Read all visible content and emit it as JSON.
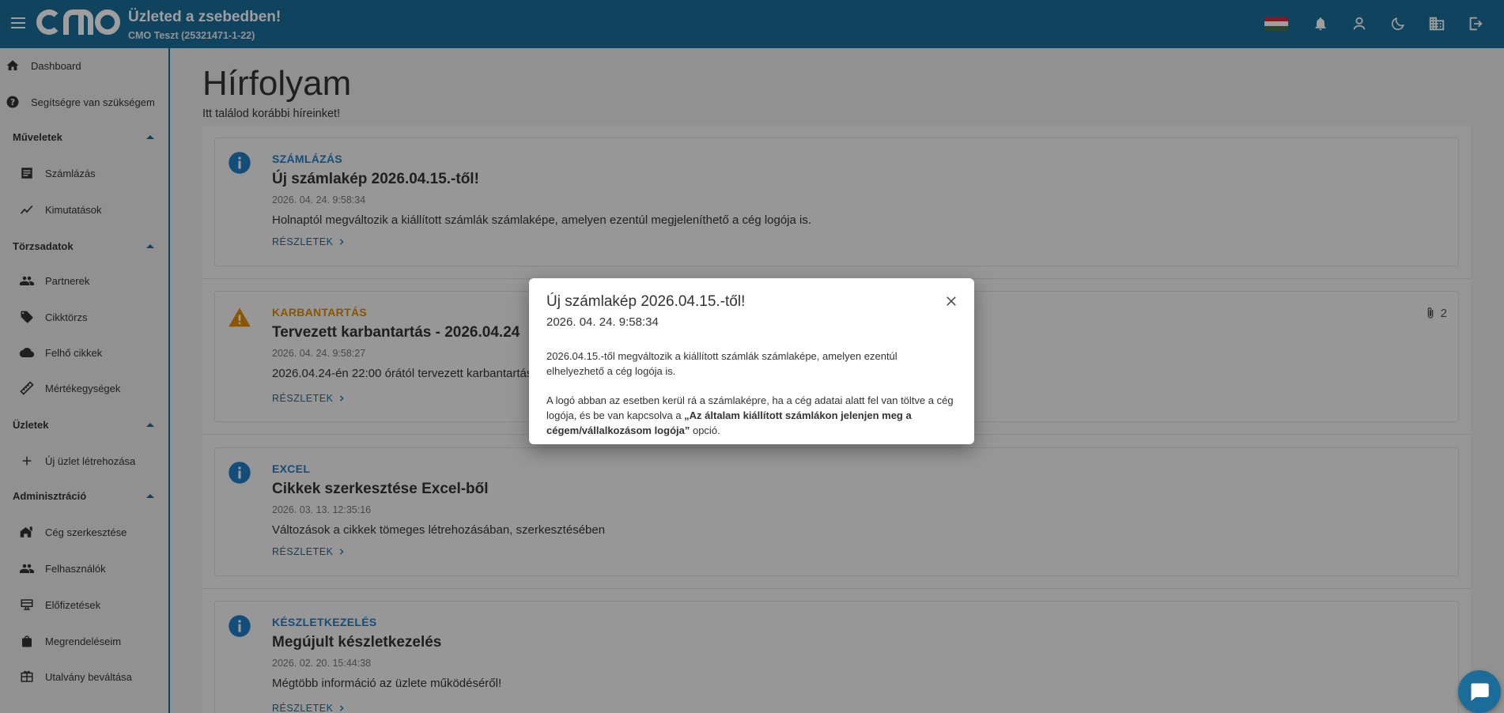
{
  "header": {
    "title": "Üzleted a zsebedben!",
    "subtitle": "CMO Teszt (25321471-1-22)",
    "flag_colors": [
      "#cd2a3e",
      "#ffffff",
      "#436f4d"
    ]
  },
  "sidebar": {
    "dashboard": "Dashboard",
    "help": "Segítségre van szükségem",
    "sections": [
      {
        "label": "Műveletek",
        "items": [
          "Számlázás",
          "Kimutatások"
        ]
      },
      {
        "label": "Törzsadatok",
        "items": [
          "Partnerek",
          "Cikktörzs",
          "Felhő cikkek",
          "Mértékegységek"
        ]
      },
      {
        "label": "Üzletek",
        "items": [
          "Új üzlet létrehozása"
        ]
      },
      {
        "label": "Adminisztráció",
        "items": [
          "Cég szerkesztése",
          "Felhasználók",
          "Előfizetések",
          "Megrendeléseim",
          "Utalvány beváltása"
        ]
      }
    ]
  },
  "main": {
    "title": "Hírfolyam",
    "subtitle": "Itt találod korábbi híreinket!",
    "details_label": "RÉSZLETEK",
    "news": [
      {
        "category": "SZÁMLÁZÁS",
        "category_color": "#1f7fc6",
        "icon": "info-icon",
        "title": "Új számlakép 2026.04.15.-től!",
        "date": "2026. 04. 24. 9:58:34",
        "text": "Holnaptól megváltozik a kiállított számlák számlaképe, amelyen ezentúl megjeleníthető a cég logója is."
      },
      {
        "category": "KARBANTARTÁS",
        "category_color": "#e08a00",
        "icon": "warning-icon",
        "title": "Tervezett karbantartás - 2026.04.24",
        "date": "2026. 04. 24. 9:58:27",
        "text": "2026.04.24-én 22:00 órától tervezett karbantartás",
        "attachments": "2"
      },
      {
        "category": "EXCEL",
        "category_color": "#1f7fc6",
        "icon": "info-icon",
        "title": "Cikkek szerkesztése Excel-ből",
        "date": "2026. 03. 13. 12:35:16",
        "text": "Változások a cikkek tömeges létrehozásában, szerkesztésében"
      },
      {
        "category": "KÉSZLETKEZELÉS",
        "category_color": "#1f7fc6",
        "icon": "info-icon",
        "title": "Megújult készletkezelés",
        "date": "2026. 02. 20. 15:44:38",
        "text": "Mégtöbb információ az üzlete működéséről!"
      }
    ]
  },
  "dialog": {
    "title": "Új számlakép 2026.04.15.-től!",
    "date": "2026. 04. 24. 9:58:34",
    "para1": "2026.04.15.-től megváltozik a kiállított számlák számlaképe, amelyen ezentúl elhelyezhető a cég logója is.",
    "para2_start": "A logó abban az esetben kerül rá a számlaképre, ha a cég adatai alatt fel van töltve a cég logója, és be van kapcsolva a ",
    "para2_bold": "„Az általam kiállított számlákon jelenjen meg a cégem/vállalkozásom logója”",
    "para2_end": " opció."
  }
}
